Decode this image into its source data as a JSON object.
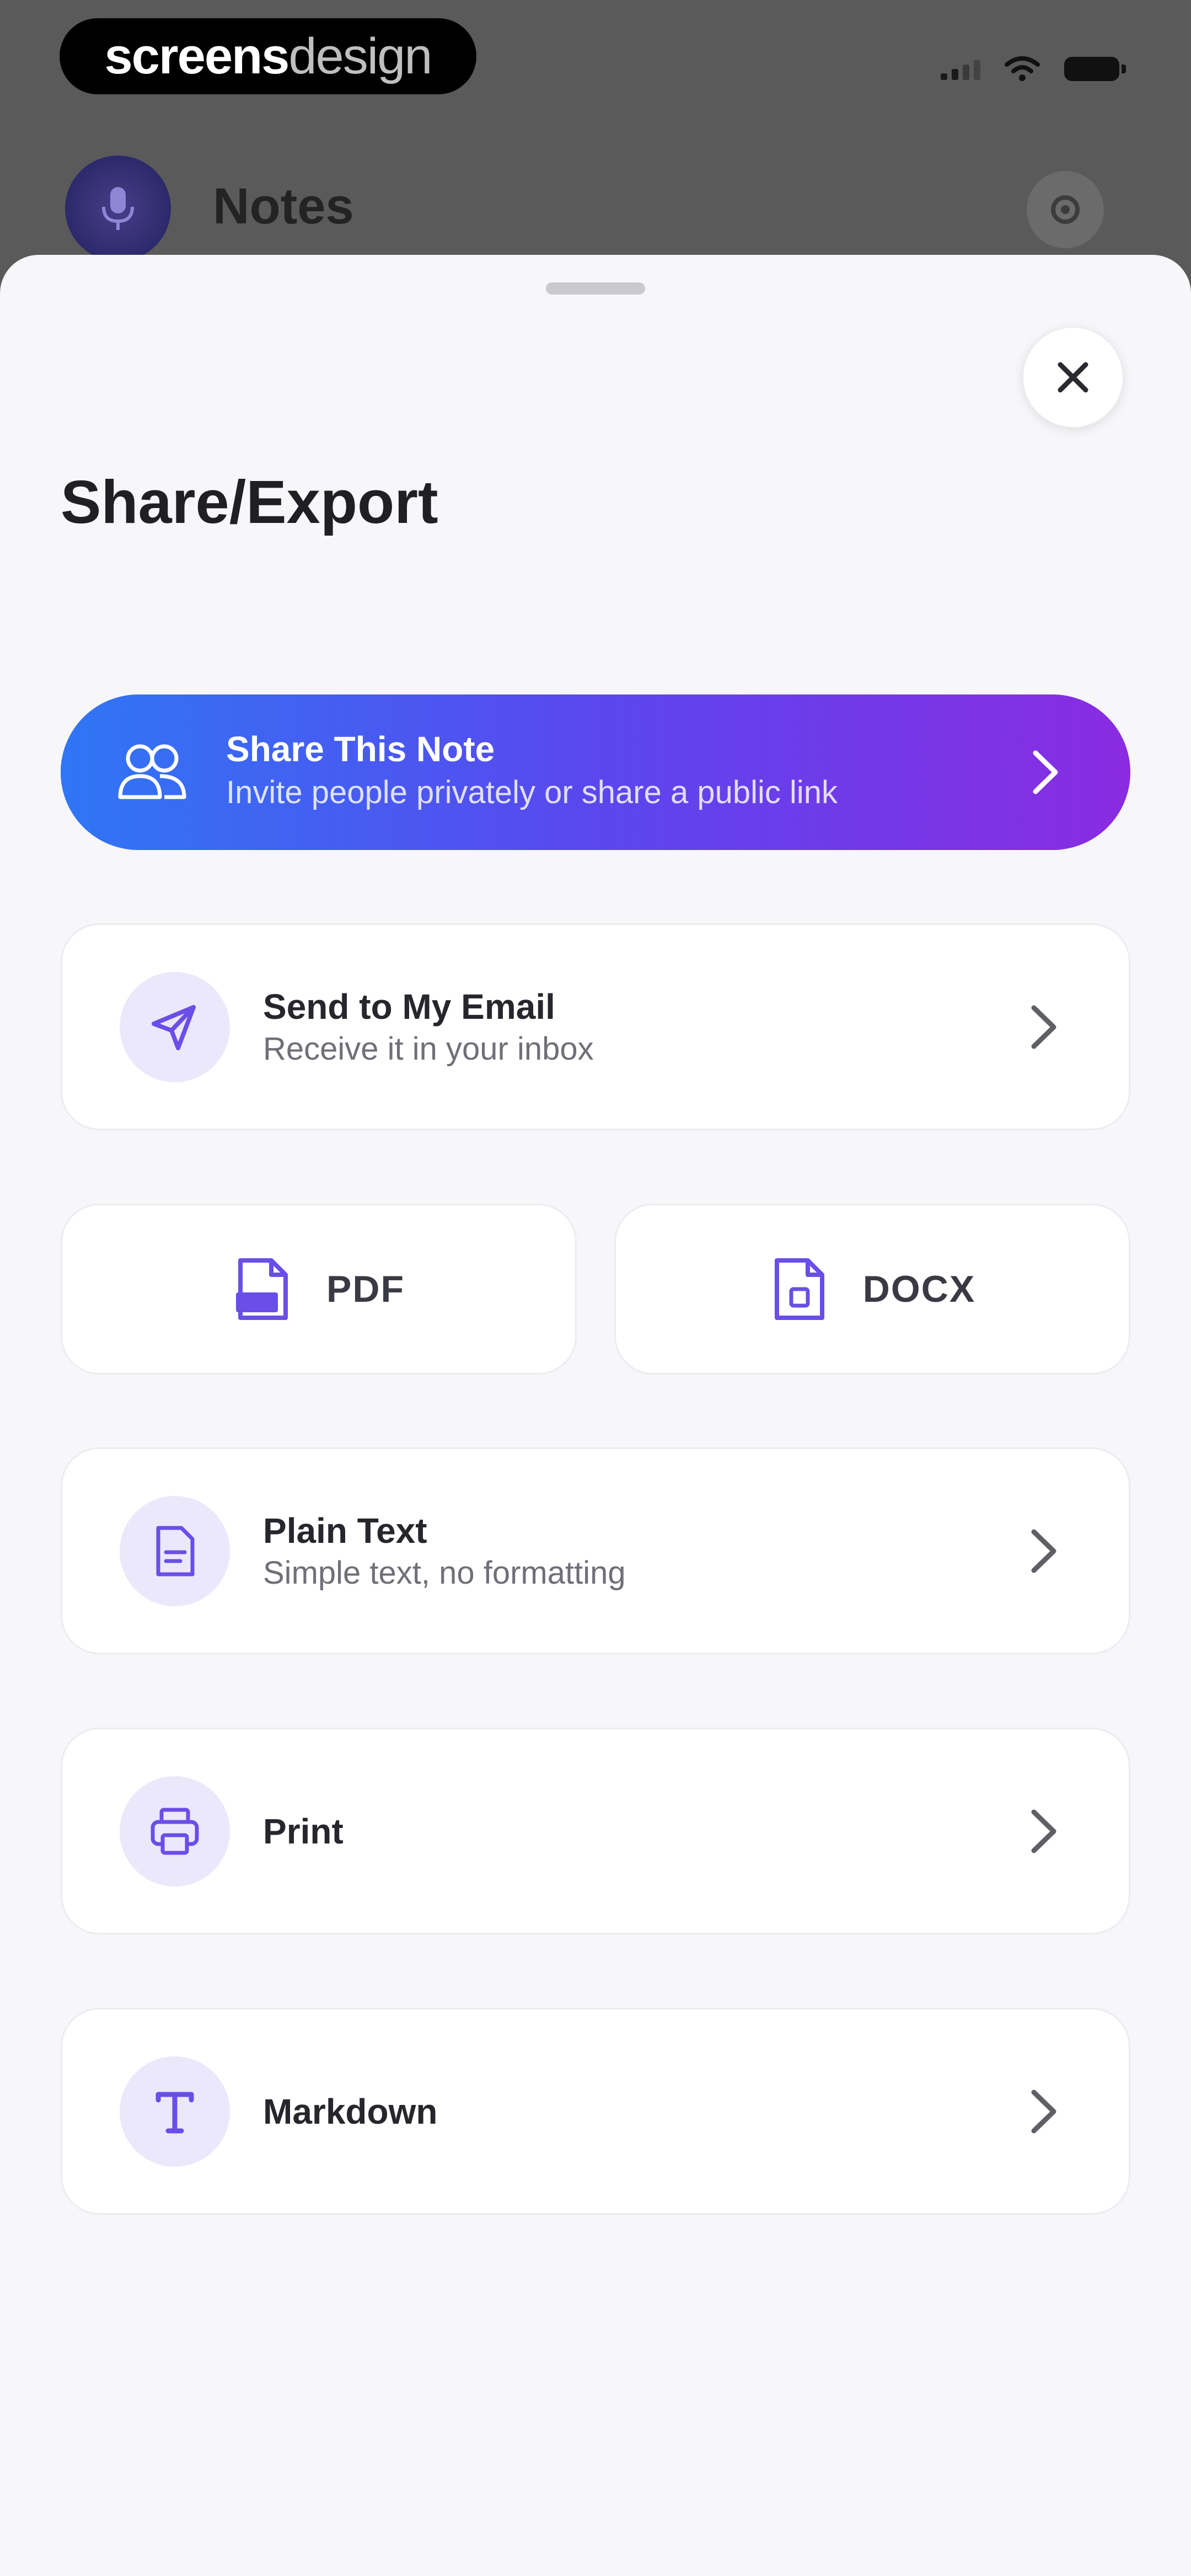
{
  "status_bar": {
    "watermark_bold": "screens",
    "watermark_light": "design"
  },
  "background_app": {
    "title": "Notes",
    "avatar_icon": "microphone-icon",
    "settings_icon": "settings-icon"
  },
  "sheet": {
    "title": "Share/Export",
    "close_icon": "close-icon",
    "share_note": {
      "title": "Share This Note",
      "subtitle": "Invite people privately or share a public link",
      "icon": "people-icon"
    },
    "email": {
      "title": "Send to My Email",
      "subtitle": "Receive it in your inbox",
      "icon": "send-icon"
    },
    "pdf": {
      "label": "PDF",
      "icon": "pdf-file-icon"
    },
    "docx": {
      "label": "DOCX",
      "icon": "docx-file-icon"
    },
    "plain_text": {
      "title": "Plain Text",
      "subtitle": "Simple text, no formatting",
      "icon": "document-icon"
    },
    "print": {
      "title": "Print",
      "icon": "printer-icon"
    },
    "markdown": {
      "title": "Markdown",
      "icon": "text-format-icon"
    }
  },
  "colors": {
    "accent": "#6a4ee8",
    "gradient_start": "#2f76f5",
    "gradient_end": "#8a2be2",
    "icon_circle": "#ece8fb",
    "sheet_bg": "#f7f7f9"
  }
}
